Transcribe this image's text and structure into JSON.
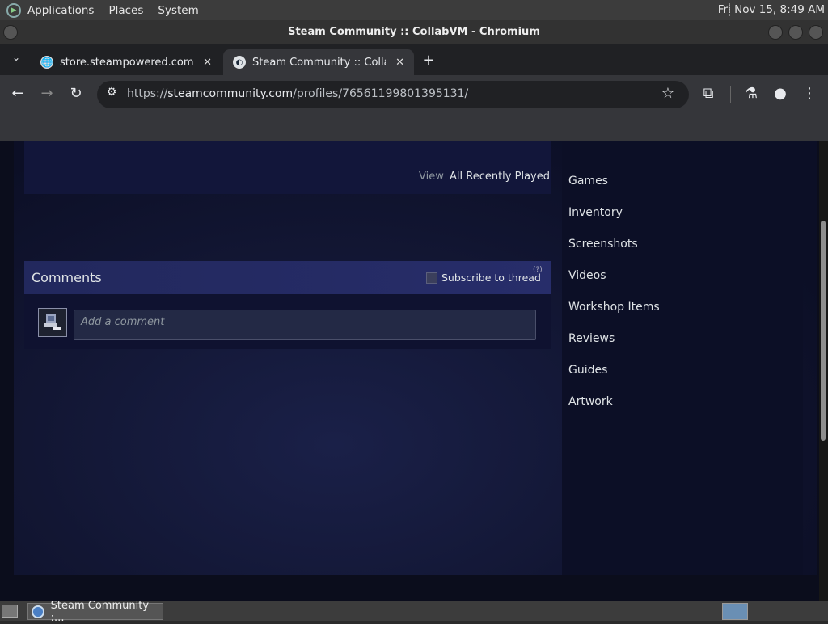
{
  "top_panel": {
    "menus": [
      "Applications",
      "Places",
      "System"
    ],
    "clock": "Fri Nov 15,  8:49 AM"
  },
  "window": {
    "title": "Steam Community :: CollabVM - Chromium"
  },
  "tabs": [
    {
      "label": "store.steampowered.com",
      "favicon": "globe-icon"
    },
    {
      "label": "Steam Community :: CollabVM",
      "favicon": "steam-icon",
      "active": true
    }
  ],
  "toolbar": {
    "url_scheme": "https://",
    "url_host": "steamcommunity.com",
    "url_path": "/profiles/76561199801395131/"
  },
  "page": {
    "view_label": "View",
    "view_value": "All Recently Played",
    "comments_title": "Comments",
    "subscribe_label": "Subscribe to thread",
    "help_mark": "(?)",
    "comment_placeholder": "Add a comment",
    "nav": [
      "Games",
      "Inventory",
      "Screenshots",
      "Videos",
      "Workshop Items",
      "Reviews",
      "Guides",
      "Artwork"
    ]
  },
  "taskbar": {
    "task_label": "Steam Community :..."
  }
}
